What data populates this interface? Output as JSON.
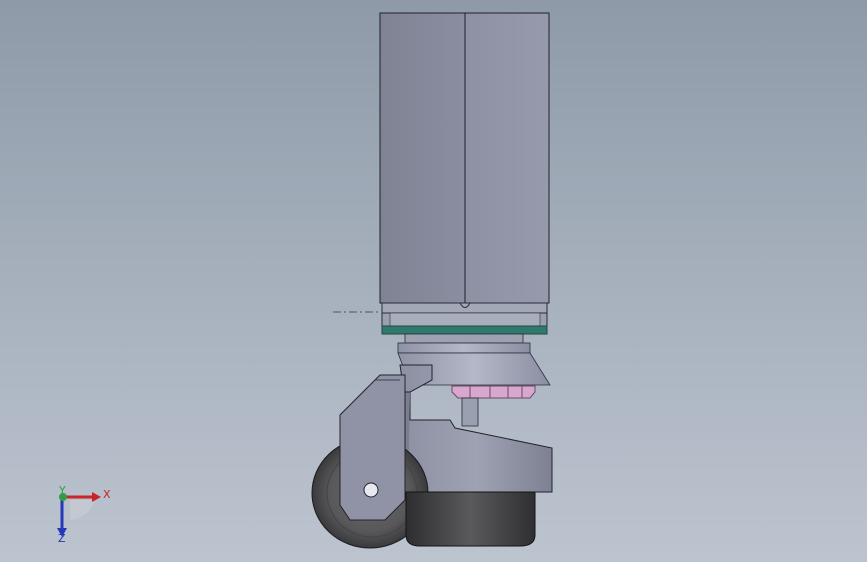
{
  "viewport": {
    "background_top": "#8e9aa8",
    "background_bottom": "#bcc4cf"
  },
  "model": {
    "post_color": "#8b8fa0",
    "plate_color": "#9aa0b2",
    "pad_color": "#2f7a6d",
    "bracket_color": "#8e93a5",
    "nut_color": "#d8a7cf",
    "wheel_color": "#5a5a5c",
    "foot_color": "#3c3c3e"
  },
  "triad": {
    "x_label": "X",
    "y_label": "Y",
    "z_label": "Z",
    "x_color": "#c8242a",
    "y_color": "#2ea043",
    "z_color": "#2438b8"
  }
}
